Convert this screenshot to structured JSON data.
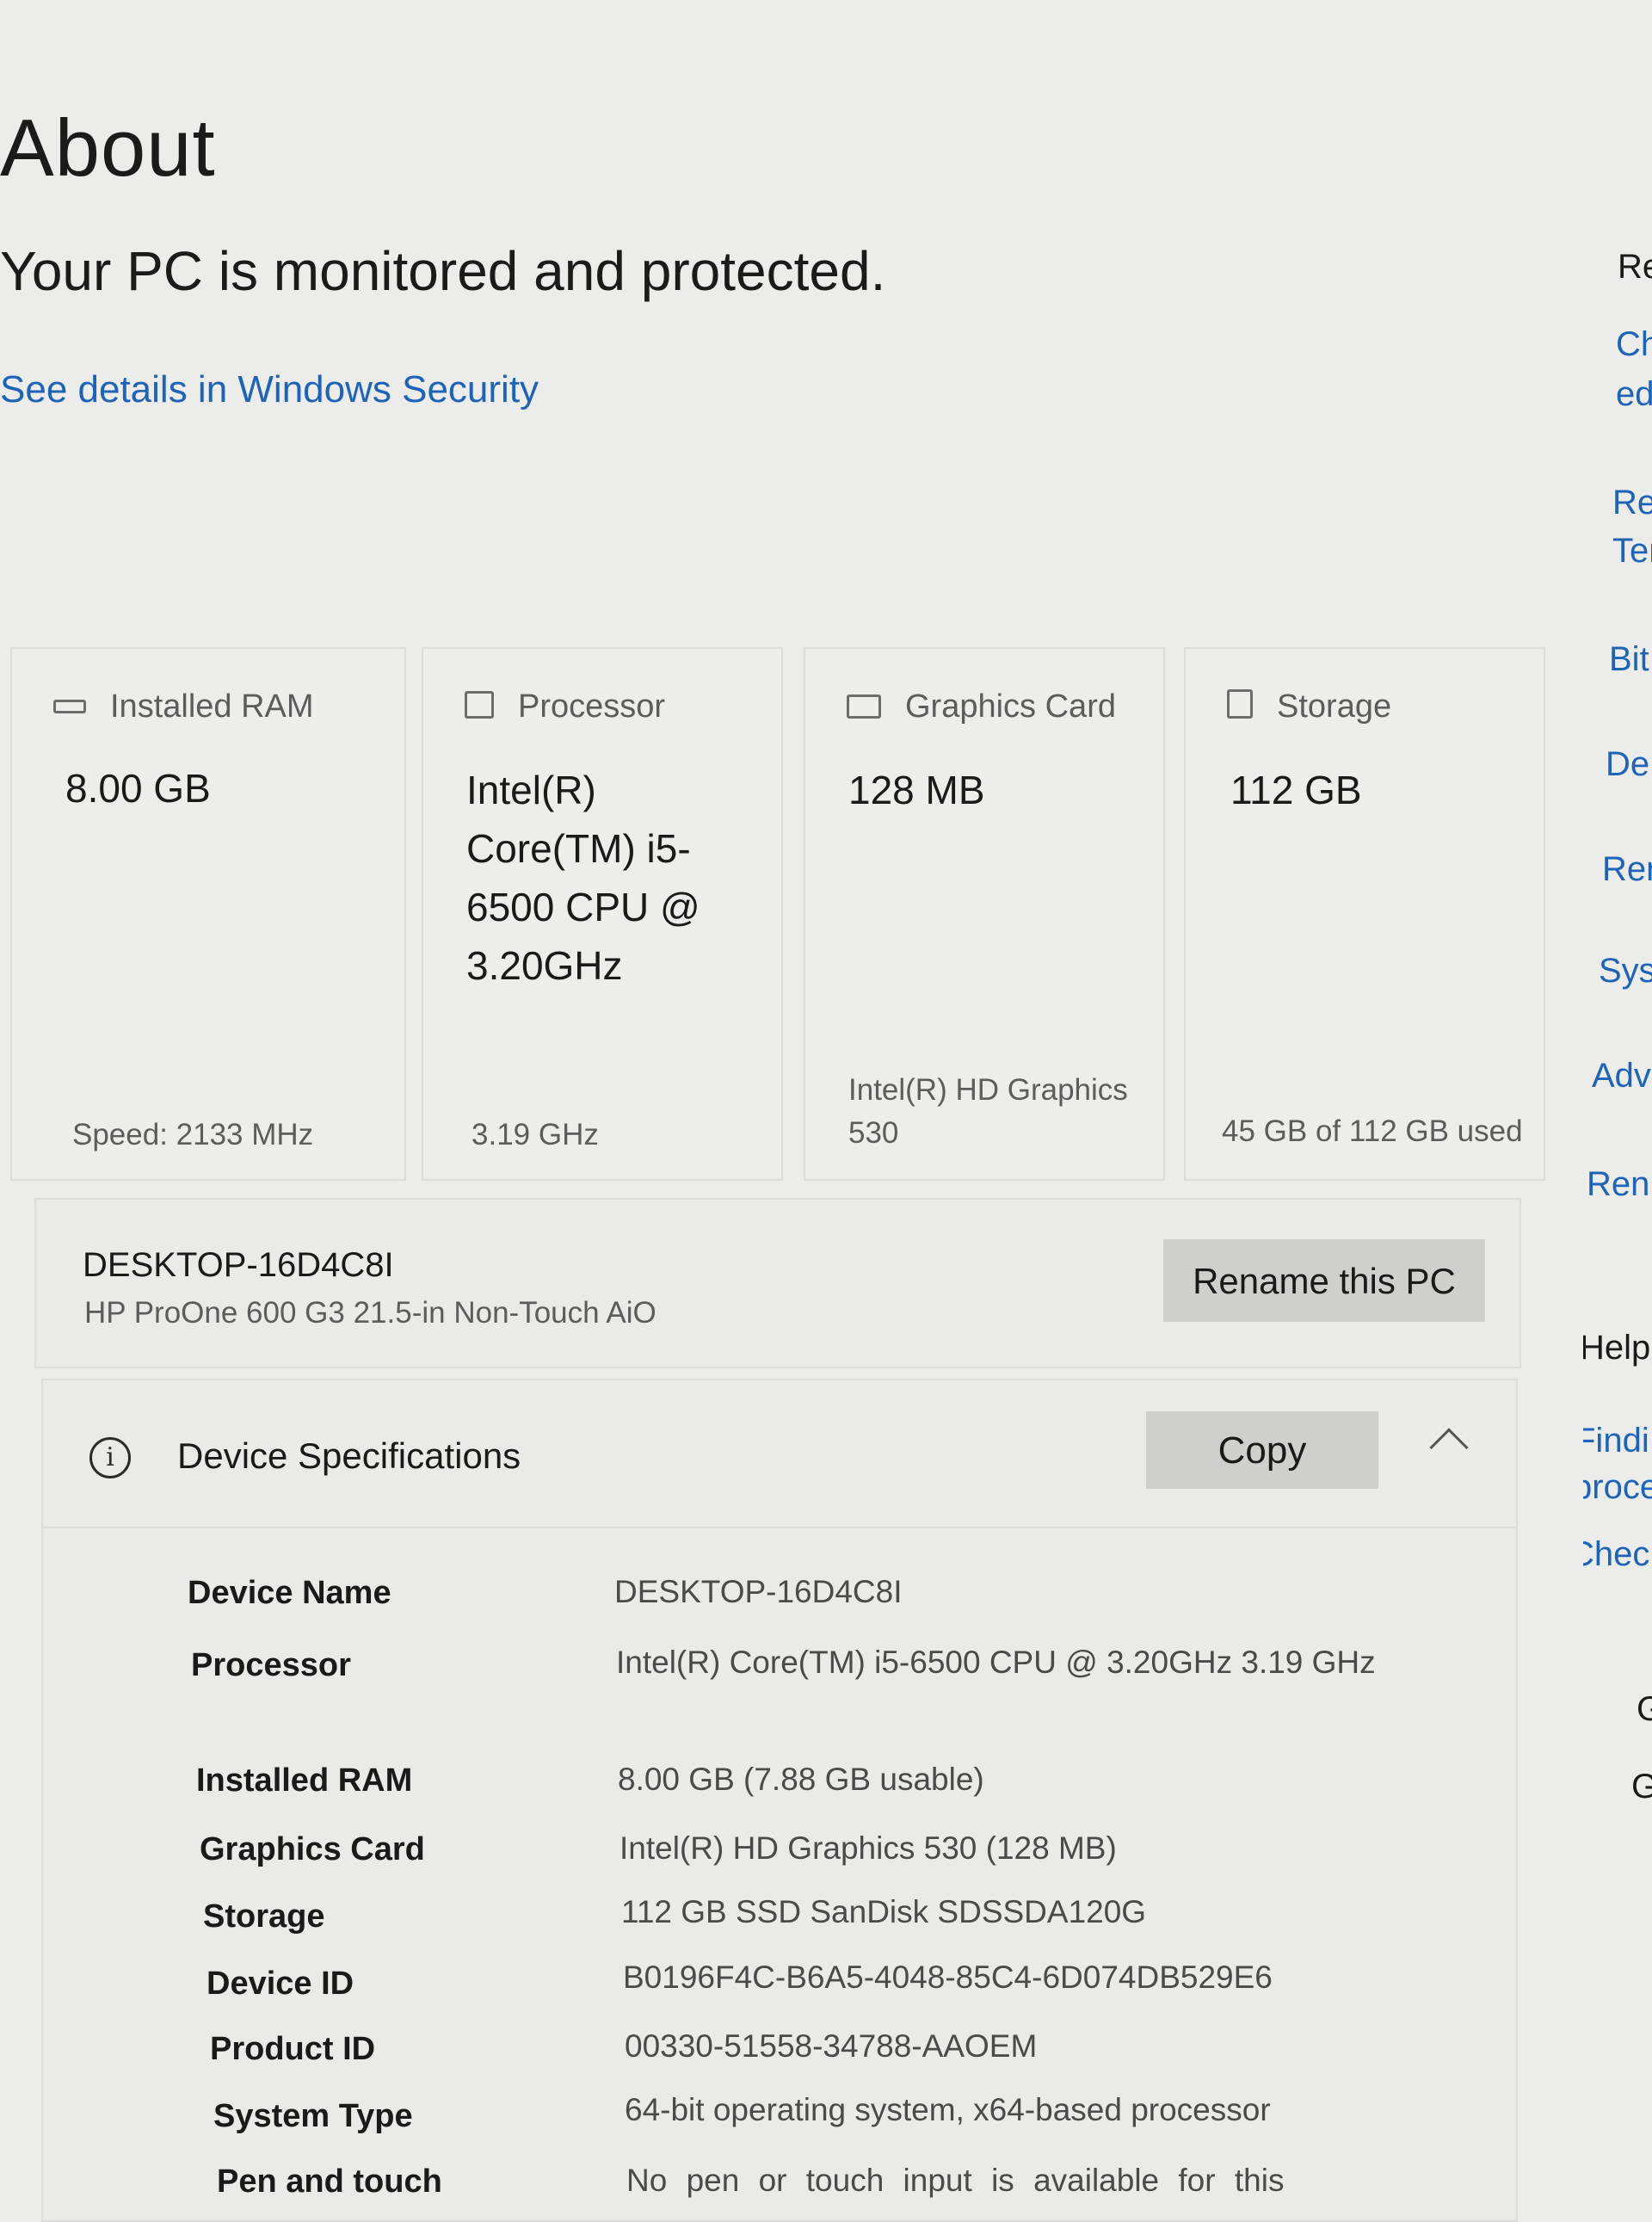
{
  "page": {
    "title": "About",
    "status": "Your PC is monitored and protected.",
    "security_link": "See details in Windows Security"
  },
  "cards": [
    {
      "title": "Installed RAM",
      "value": "8.00 GB",
      "detail": "Speed: 2133 MHz",
      "icon": "ram-icon"
    },
    {
      "title": "Processor",
      "value": "Intel(R) Core(TM) i5-6500 CPU @ 3.20GHz",
      "detail": "3.19 GHz",
      "icon": "processor-icon"
    },
    {
      "title": "Graphics Card",
      "value": "128 MB",
      "detail": "Intel(R) HD Graphics 530",
      "icon": "graphics-card-icon"
    },
    {
      "title": "Storage",
      "value": "112 GB",
      "detail": "45 GB of 112 GB used",
      "icon": "storage-icon"
    }
  ],
  "device": {
    "name": "DESKTOP-16D4C8I",
    "model": "HP ProOne 600 G3 21.5-in Non-Touch AiO",
    "rename_label": "Rename this PC"
  },
  "specs": {
    "title": "Device Specifications",
    "copy_label": "Copy",
    "rows": [
      {
        "label": "Device Name",
        "value": "DESKTOP-16D4C8I"
      },
      {
        "label": "Processor",
        "value": "Intel(R) Core(TM) i5-6500 CPU @ 3.20GHz   3.19 GHz"
      },
      {
        "label": "Installed RAM",
        "value": "8.00 GB (7.88 GB usable)"
      },
      {
        "label": "Graphics Card",
        "value": "Intel(R) HD Graphics 530 (128 MB)"
      },
      {
        "label": "Storage",
        "value": "112 GB SSD SanDisk SDSSDA120G"
      },
      {
        "label": "Device ID",
        "value": "B0196F4C-B6A5-4048-85C4-6D074DB529E6"
      },
      {
        "label": "Product ID",
        "value": "00330-51558-34788-AAOEM"
      },
      {
        "label": "System Type",
        "value": "64-bit operating system, x64-based processor"
      },
      {
        "label": "Pen and touch",
        "value": "No pen or touch input is available for this"
      }
    ]
  },
  "related": {
    "items": [
      "Re",
      "Ch",
      "ed",
      "Re",
      "Ter",
      "Bit",
      "De",
      "Rer",
      "Syst",
      "Adv",
      "Ren"
    ],
    "help_heading": "Help",
    "help_items": [
      "Findi",
      "proce",
      "Check"
    ],
    "bottom_items": [
      "G",
      "G"
    ]
  },
  "colors": {
    "accent": "#1f63b6",
    "background": "#ececea",
    "button": "#cfcfcd"
  }
}
